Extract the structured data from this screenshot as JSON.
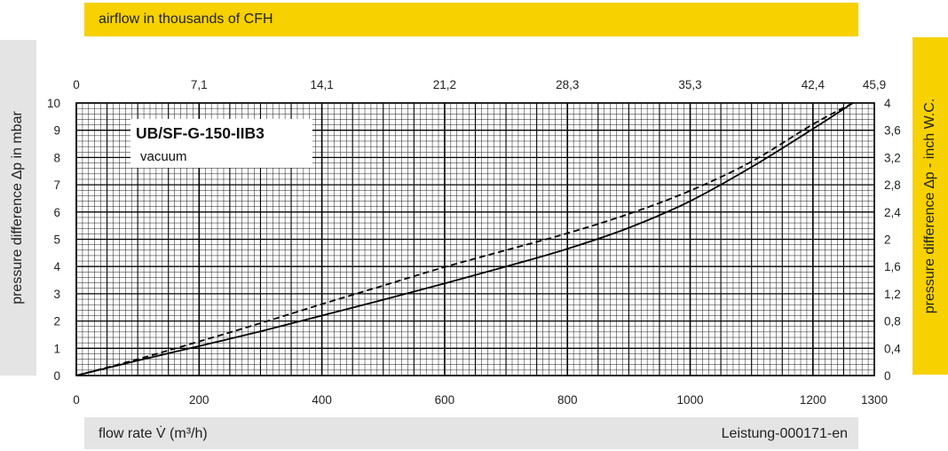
{
  "header_band": {
    "label": "airflow in thousands of CFH",
    "color": "#f7d100"
  },
  "left_band": {
    "label": "pressure difference ∆p in mbar",
    "color": "#e4e4e4"
  },
  "right_band": {
    "label": "pressure difference ∆p  - inch W.C.",
    "color": "#f7d100"
  },
  "footer_band": {
    "label": "flow rate V̇ (m³/h)",
    "doc_id": "Leistung-000171-en",
    "color": "#e4e4e4"
  },
  "chart_data": {
    "type": "line",
    "title": "UB/SF-G-150-IIB3",
    "subtitle": "vacuum",
    "xlabel": "flow rate V̇ (m³/h)",
    "ylabel": "pressure difference ∆p in mbar",
    "x2label": "airflow in thousands of CFH",
    "y2label": "pressure difference ∆p  - inch W.C.",
    "xlim": [
      0,
      1300
    ],
    "ylim": [
      0,
      10
    ],
    "x_ticks": [
      0,
      200,
      400,
      600,
      800,
      1000,
      1200,
      1300
    ],
    "y_ticks": [
      0,
      1,
      2,
      3,
      4,
      5,
      6,
      7,
      8,
      9,
      10
    ],
    "x2_ticks": [
      {
        "label": "0",
        "at": 0
      },
      {
        "label": "7,1",
        "at": 200
      },
      {
        "label": "14,1",
        "at": 400
      },
      {
        "label": "21,2",
        "at": 600
      },
      {
        "label": "28,3",
        "at": 800
      },
      {
        "label": "35,3",
        "at": 1000
      },
      {
        "label": "42,4",
        "at": 1200
      },
      {
        "label": "45,9",
        "at": 1300
      }
    ],
    "y2_ticks": [
      {
        "label": "0",
        "at": 0
      },
      {
        "label": "0,4",
        "at": 1
      },
      {
        "label": "0,8",
        "at": 2
      },
      {
        "label": "1,2",
        "at": 3
      },
      {
        "label": "1,6",
        "at": 4
      },
      {
        "label": "2",
        "at": 5
      },
      {
        "label": "2,4",
        "at": 6
      },
      {
        "label": "2,8",
        "at": 7
      },
      {
        "label": "3,2",
        "at": 8
      },
      {
        "label": "3,6",
        "at": 9
      },
      {
        "label": "4",
        "at": 10
      }
    ],
    "grid": true,
    "series": [
      {
        "style": "solid",
        "x": [
          0,
          100,
          200,
          300,
          400,
          500,
          600,
          700,
          800,
          900,
          1000,
          1100,
          1200,
          1265
        ],
        "y": [
          0,
          0.55,
          1.08,
          1.62,
          2.2,
          2.78,
          3.38,
          4.0,
          4.65,
          5.42,
          6.4,
          7.65,
          9.05,
          10.0
        ]
      },
      {
        "style": "dashed",
        "x": [
          0,
          100,
          200,
          300,
          400,
          500,
          600,
          700,
          800,
          900,
          1000,
          1100,
          1200,
          1265
        ],
        "y": [
          0,
          0.6,
          1.25,
          1.92,
          2.62,
          3.3,
          3.98,
          4.6,
          5.22,
          5.93,
          6.78,
          7.85,
          9.22,
          10.0
        ]
      }
    ]
  }
}
